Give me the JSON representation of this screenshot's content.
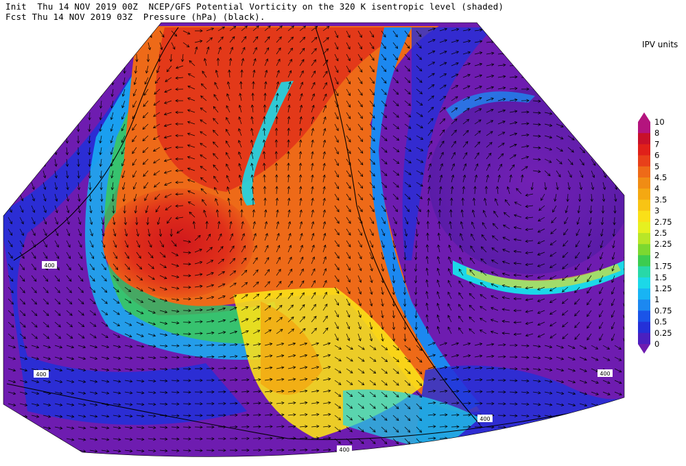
{
  "header": {
    "line1": "Init  Thu 14 NOV 2019 00Z  NCEP/GFS Potential Vorticity on the 320 K isentropic level (shaded)",
    "line2": "Fcst Thu 14 NOV 2019 03Z  Pressure (hPa) (black)."
  },
  "colorbar": {
    "unit_label": "IPV units",
    "levels": [
      {
        "label": "10",
        "color": "#b4147e"
      },
      {
        "label": "8",
        "color": "#c8102a"
      },
      {
        "label": "7",
        "color": "#e0201a"
      },
      {
        "label": "6",
        "color": "#e8401a"
      },
      {
        "label": "5",
        "color": "#ee6a18"
      },
      {
        "label": "4.5",
        "color": "#f08c14"
      },
      {
        "label": "4",
        "color": "#f4a812"
      },
      {
        "label": "3.5",
        "color": "#f8c414"
      },
      {
        "label": "3",
        "color": "#fae018"
      },
      {
        "label": "2.75",
        "color": "#e6f020"
      },
      {
        "label": "2.5",
        "color": "#b8e628"
      },
      {
        "label": "2.25",
        "color": "#7cd830"
      },
      {
        "label": "2",
        "color": "#3ccc50"
      },
      {
        "label": "1.75",
        "color": "#28d8a8"
      },
      {
        "label": "1.5",
        "color": "#1cd8e8"
      },
      {
        "label": "1.25",
        "color": "#18b4f4"
      },
      {
        "label": "1",
        "color": "#1c88f0"
      },
      {
        "label": "0.75",
        "color": "#1a54e8"
      },
      {
        "label": "0.5",
        "color": "#2430d8"
      },
      {
        "label": "0.25",
        "color": "#4a20c0"
      },
      {
        "label": "0",
        "color": "#6e1cb0"
      }
    ]
  },
  "pressure_labels": [
    "400",
    "400",
    "400",
    "400",
    "400"
  ],
  "colors": {
    "background": "#ffffff",
    "low_pv": "#6e1cb0",
    "high_pv": "#e0201a",
    "isobar": "#000000",
    "coastline": "#c8c8c8"
  }
}
